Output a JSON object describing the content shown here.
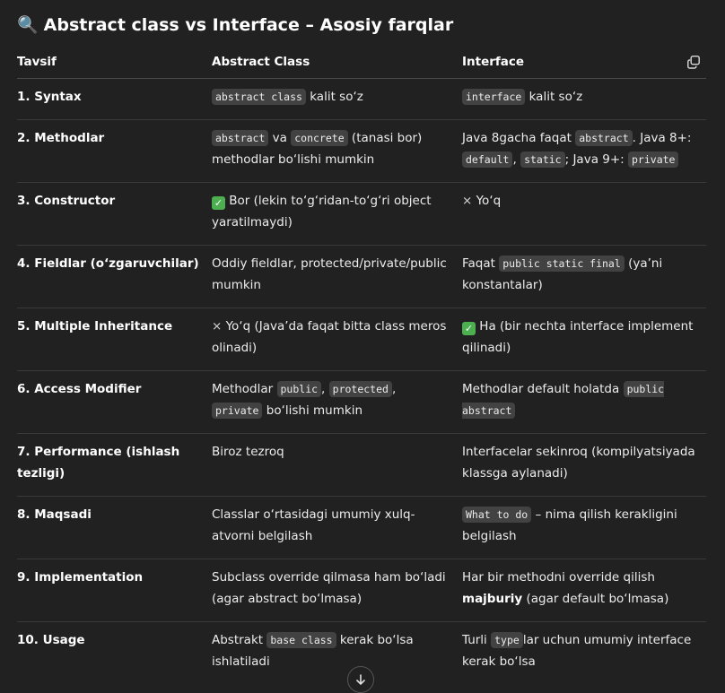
{
  "title": {
    "emoji": "🔍",
    "text": "Abstract class vs Interface – Asosiy farqlar"
  },
  "columns": [
    "Tavsif",
    "Abstract Class",
    "Interface"
  ],
  "rows": [
    {
      "key": "1. Syntax",
      "abstract": [
        {
          "t": "code",
          "v": "abstract class"
        },
        {
          "t": "text",
          "v": " kalit so‘z"
        }
      ],
      "interface": [
        {
          "t": "code",
          "v": "interface"
        },
        {
          "t": "text",
          "v": " kalit so‘z"
        }
      ]
    },
    {
      "key": "2. Methodlar",
      "abstract": [
        {
          "t": "code",
          "v": "abstract"
        },
        {
          "t": "text",
          "v": " va "
        },
        {
          "t": "code",
          "v": "concrete"
        },
        {
          "t": "text",
          "v": " (tanasi bor) methodlar bo‘lishi mumkin"
        }
      ],
      "interface": [
        {
          "t": "text",
          "v": "Java 8gacha faqat "
        },
        {
          "t": "code",
          "v": "abstract"
        },
        {
          "t": "text",
          "v": ". Java 8+: "
        },
        {
          "t": "code",
          "v": "default"
        },
        {
          "t": "text",
          "v": ", "
        },
        {
          "t": "code",
          "v": "static"
        },
        {
          "t": "text",
          "v": "; Java 9+: "
        },
        {
          "t": "code",
          "v": "private"
        }
      ]
    },
    {
      "key": "3. Constructor",
      "abstract": [
        {
          "t": "check",
          "v": "✓"
        },
        {
          "t": "text",
          "v": " Bor (lekin to‘g‘ridan-to‘g‘ri object yaratilmaydi)"
        }
      ],
      "interface": [
        {
          "t": "cross",
          "v": "×"
        },
        {
          "t": "text",
          "v": " Yo‘q"
        }
      ]
    },
    {
      "key": "4. Fieldlar (o‘zgaruvchilar)",
      "abstract": [
        {
          "t": "text",
          "v": "Oddiy fieldlar, protected/private/public mumkin"
        }
      ],
      "interface": [
        {
          "t": "text",
          "v": "Faqat "
        },
        {
          "t": "code",
          "v": "public static final"
        },
        {
          "t": "text",
          "v": " (ya’ni konstantalar)"
        }
      ]
    },
    {
      "key": "5. Multiple Inheritance",
      "abstract": [
        {
          "t": "cross",
          "v": "×"
        },
        {
          "t": "text",
          "v": " Yo‘q (Java’da faqat bitta class meros olinadi)"
        }
      ],
      "interface": [
        {
          "t": "check",
          "v": "✓"
        },
        {
          "t": "text",
          "v": " Ha (bir nechta interface implement qilinadi)"
        }
      ]
    },
    {
      "key": "6. Access Modifier",
      "abstract": [
        {
          "t": "text",
          "v": "Methodlar "
        },
        {
          "t": "code",
          "v": "public"
        },
        {
          "t": "text",
          "v": ", "
        },
        {
          "t": "code",
          "v": "protected"
        },
        {
          "t": "text",
          "v": ", "
        },
        {
          "t": "code",
          "v": "private"
        },
        {
          "t": "text",
          "v": " bo‘lishi mumkin"
        }
      ],
      "interface": [
        {
          "t": "text",
          "v": "Methodlar default holatda "
        },
        {
          "t": "code",
          "v": "public abstract"
        }
      ]
    },
    {
      "key": "7. Performance (ishlash tezligi)",
      "abstract": [
        {
          "t": "text",
          "v": "Biroz tezroq"
        }
      ],
      "interface": [
        {
          "t": "text",
          "v": "Interfacelar sekinroq (kompilyatsiyada klassga aylanadi)"
        }
      ]
    },
    {
      "key": "8. Maqsadi",
      "abstract": [
        {
          "t": "text",
          "v": "Classlar o‘rtasidagi umumiy xulq-atvorni belgilash"
        }
      ],
      "interface": [
        {
          "t": "code",
          "v": "What to do"
        },
        {
          "t": "text",
          "v": " – nima qilish kerakligini belgilash"
        }
      ]
    },
    {
      "key": "9. Implementation",
      "abstract": [
        {
          "t": "text",
          "v": "Subclass override qilmasa ham bo‘ladi (agar abstract bo‘lmasa)"
        }
      ],
      "interface": [
        {
          "t": "text",
          "v": "Har bir methodni override qilish "
        },
        {
          "t": "bold",
          "v": "majburiy"
        },
        {
          "t": "text",
          "v": " (agar default bo‘lmasa)"
        }
      ]
    },
    {
      "key": "10. Usage",
      "abstract": [
        {
          "t": "text",
          "v": "Abstrakt "
        },
        {
          "t": "code",
          "v": "base class"
        },
        {
          "t": "text",
          "v": " kerak bo‘lsa ishlatiladi"
        }
      ],
      "interface": [
        {
          "t": "text",
          "v": "Turli "
        },
        {
          "t": "code",
          "v": "type"
        },
        {
          "t": "text",
          "v": "lar uchun umumiy interface kerak bo‘lsa"
        }
      ]
    }
  ]
}
